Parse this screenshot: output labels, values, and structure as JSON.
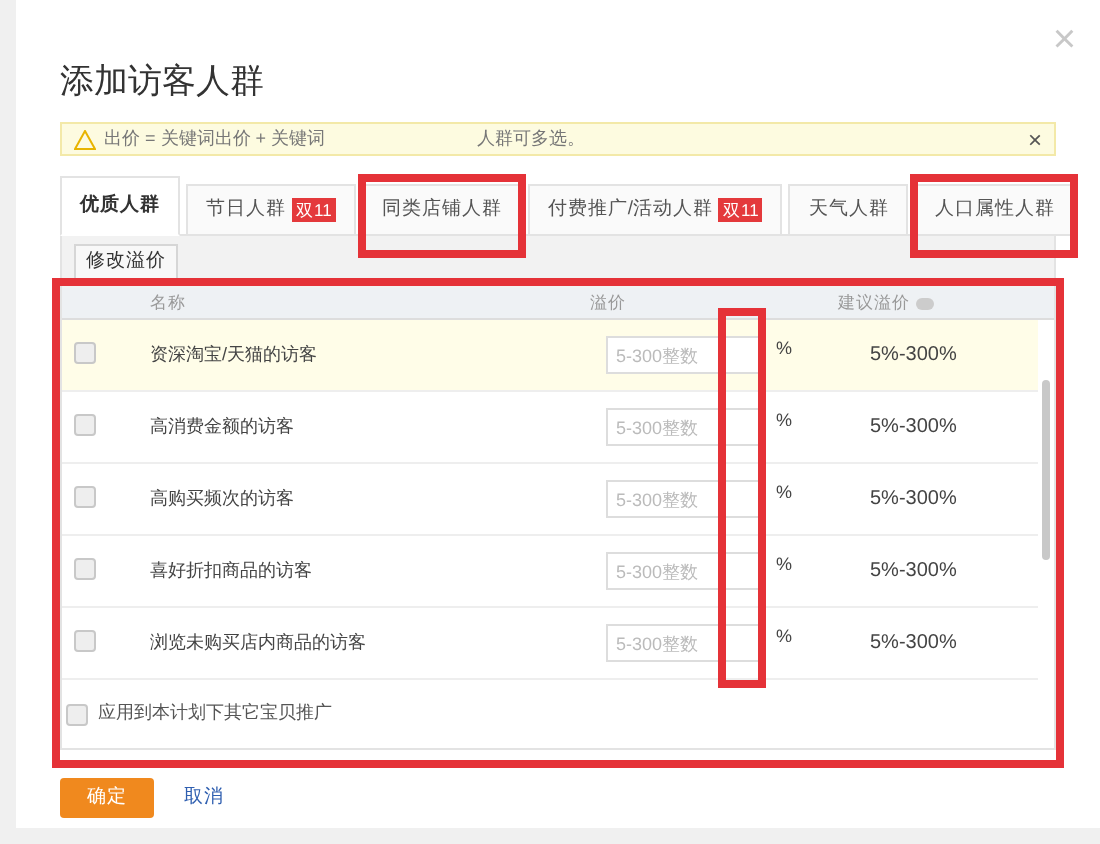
{
  "dialog": {
    "title": "添加访客人群",
    "close": "×"
  },
  "notice": {
    "parts": [
      "出价 = 关键词出价 + 关键词",
      "人群可多选。"
    ],
    "close": "×"
  },
  "tabs": [
    {
      "label": "优质人群",
      "selected": true
    },
    {
      "label": "节日人群",
      "badge": "双11",
      "selected": false
    },
    {
      "label": "同类店铺人群",
      "selected": false,
      "highlighted": true
    },
    {
      "label": "付费推广/活动人群",
      "badge": "双11",
      "selected": false
    },
    {
      "label": "天气人群",
      "selected": false
    },
    {
      "label": "人口属性人群",
      "selected": false,
      "highlighted": true
    }
  ],
  "toolbar": {
    "button": "修改溢价"
  },
  "table": {
    "columns": [
      "名称",
      "溢价",
      "建议溢价"
    ],
    "rows": [
      {
        "name": "资深淘宝/天猫的访客",
        "placeholder": "5-300整数",
        "unit": "%",
        "suggested": "5%-300%",
        "checked": false,
        "selected": true
      },
      {
        "name": "高消费金额的访客",
        "placeholder": "5-300整数",
        "unit": "%",
        "suggested": "5%-300%",
        "checked": false,
        "selected": false
      },
      {
        "name": "高购买频次的访客",
        "placeholder": "5-300整数",
        "unit": "%",
        "suggested": "5%-300%",
        "checked": false,
        "selected": false
      },
      {
        "name": "喜好折扣商品的访客",
        "placeholder": "5-300整数",
        "unit": "%",
        "suggested": "5%-300%",
        "checked": false,
        "selected": false
      },
      {
        "name": "浏览未购买店内商品的访客",
        "placeholder": "5-300整数",
        "unit": "%",
        "suggested": "5%-300%",
        "checked": false,
        "selected": false
      }
    ]
  },
  "apply_all": {
    "label": "应用到本计划下其它宝贝推广",
    "checked": false
  },
  "buttons": {
    "confirm": "确定",
    "cancel": "取消"
  }
}
